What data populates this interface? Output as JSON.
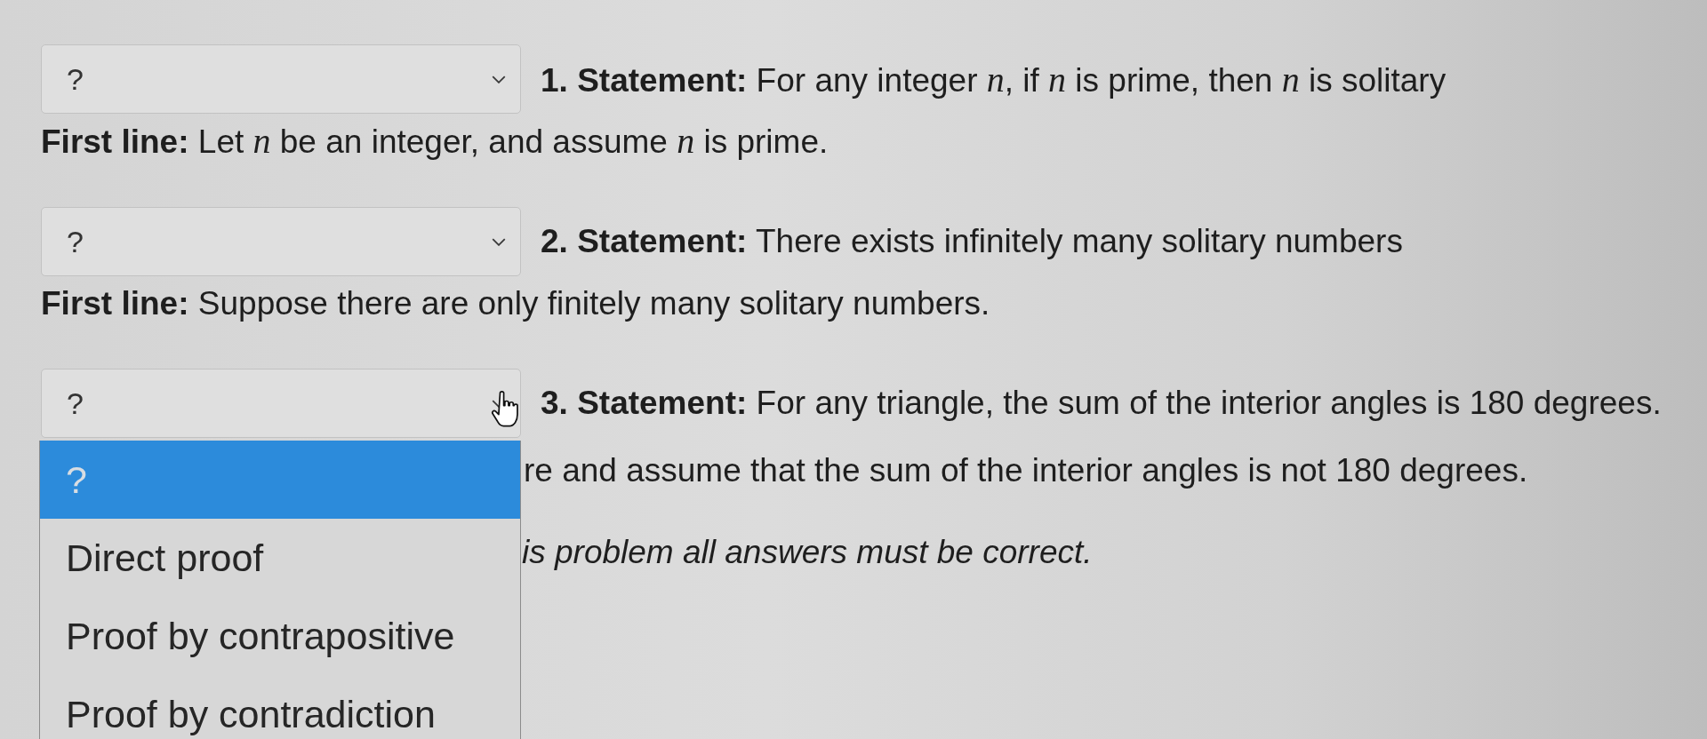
{
  "questions": [
    {
      "select": {
        "value": "?",
        "open": false
      },
      "statement": "**1. Statement:** For any integer *n*, if *n* is prime, then *n* is solitary",
      "first_line": "**First line:** Let *n* be an integer, and assume *n* is prime."
    },
    {
      "select": {
        "value": "?",
        "open": false
      },
      "statement": "**2. Statement:** There exists infinitely many solitary numbers",
      "first_line": "**First line:** Suppose there are only finitely many solitary numbers."
    },
    {
      "select": {
        "value": "?",
        "open": true,
        "options": [
          {
            "label": "?",
            "selected": true
          },
          {
            "label": "Direct proof",
            "selected": false
          },
          {
            "label": "Proof by contrapositive",
            "selected": false
          },
          {
            "label": "Proof by contradiction",
            "selected": false
          }
        ]
      },
      "statement": "**3. Statement:** For any triangle, the sum of the interior angles is 180 degrees.",
      "first_line": "re and assume that the sum of the interior angles is not 180 degrees."
    }
  ],
  "note": "is problem all answers must be correct."
}
